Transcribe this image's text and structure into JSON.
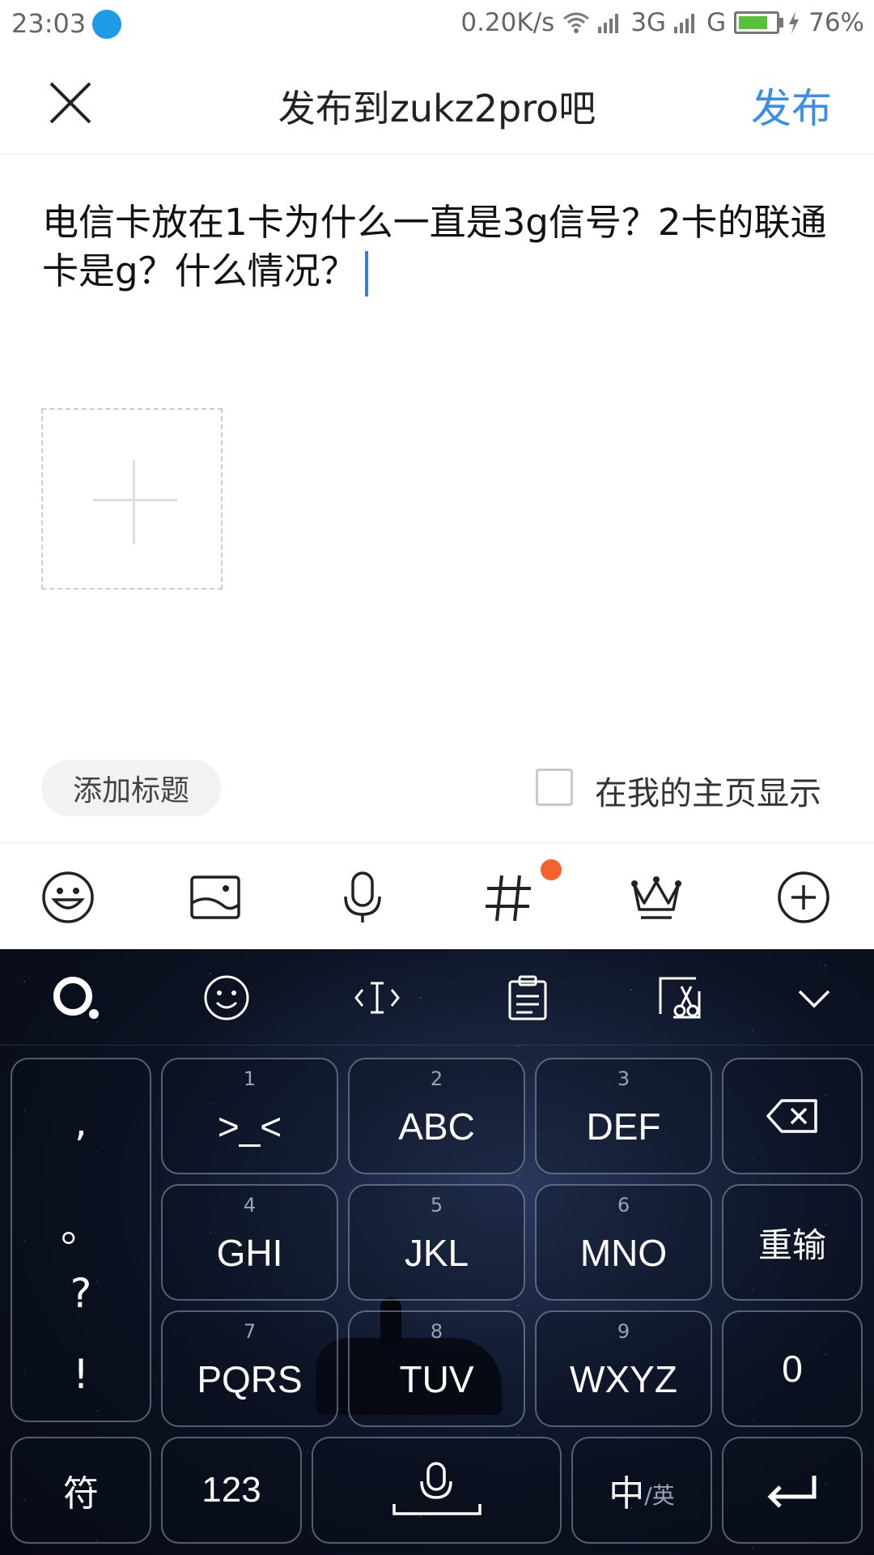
{
  "status_bar": {
    "time": "23:03",
    "network_speed": "0.20K/s",
    "signal_1": "3G",
    "signal_2": "G",
    "battery": "76%"
  },
  "header": {
    "title": "发布到zukz2pro吧",
    "publish_label": "发布",
    "close_icon": "close-icon"
  },
  "post": {
    "text": "电信卡放在1卡为什么一直是3g信号？2卡的联通卡是g？什么情况？"
  },
  "options": {
    "add_title_label": "添加标题",
    "show_on_homepage_label": "在我的主页显示",
    "show_on_homepage_checked": false
  },
  "toolbar": {
    "icons": [
      "emoji-icon",
      "image-icon",
      "microphone-icon",
      "hashtag-icon",
      "crown-icon",
      "plus-circle-icon"
    ]
  },
  "keyboard": {
    "tools": [
      "logo-icon",
      "emoji-icon",
      "cursor-icon",
      "clipboard-icon",
      "edit-icon",
      "collapse-icon"
    ],
    "punct": [
      ",",
      "。",
      "?",
      "!"
    ],
    "keys": [
      {
        "num": "1",
        "label": ">_<"
      },
      {
        "num": "2",
        "label": "ABC"
      },
      {
        "num": "3",
        "label": "DEF"
      },
      {
        "num": "4",
        "label": "GHI"
      },
      {
        "num": "5",
        "label": "JKL"
      },
      {
        "num": "6",
        "label": "MNO"
      },
      {
        "num": "7",
        "label": "PQRS"
      },
      {
        "num": "8",
        "label": "TUV"
      },
      {
        "num": "9",
        "label": "WXYZ"
      }
    ],
    "reenter_label": "重输",
    "zero_label": "0",
    "symbol_label": "符",
    "numbers_label": "123",
    "lang_main": "中",
    "lang_alt": "/英"
  },
  "colors": {
    "accent": "#3a8ee6",
    "notify_dot": "#f4632f",
    "caret": "#3a7be6"
  }
}
